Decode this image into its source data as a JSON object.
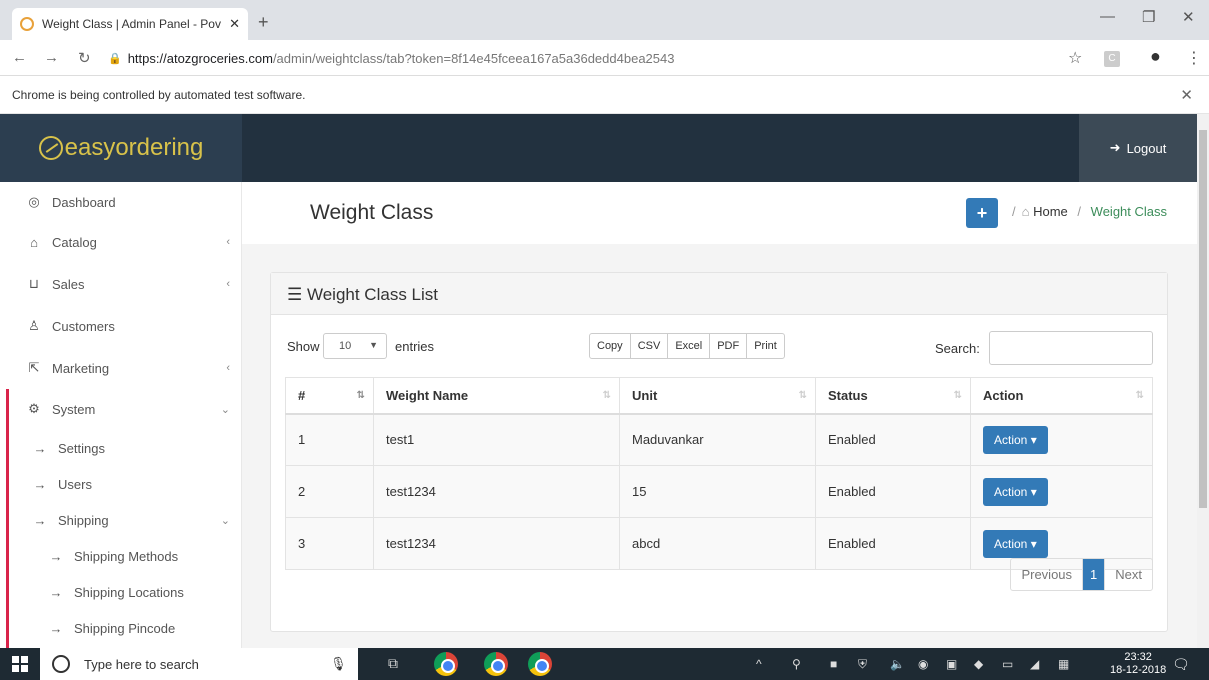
{
  "browser": {
    "tab_title": "Weight Class | Admin Panel - Pov",
    "url_host": "https://atozgroceries.com",
    "url_path": "/admin/weightclass/tab?token=8f14e45fceea167a5a36dedd4bea2543",
    "automation_notice": "Chrome is being controlled by automated test software."
  },
  "header": {
    "logo_text": "easyordering",
    "logout_label": "Logout"
  },
  "sidebar": {
    "items": [
      {
        "label": "Dashboard",
        "icon": "dashboard-icon"
      },
      {
        "label": "Catalog",
        "icon": "tag-icon"
      },
      {
        "label": "Sales",
        "icon": "cart-icon"
      },
      {
        "label": "Customers",
        "icon": "user-icon"
      },
      {
        "label": "Marketing",
        "icon": "share-icon"
      },
      {
        "label": "System",
        "icon": "gear-icon"
      },
      {
        "label": "Settings",
        "icon": "arrow-right-icon"
      },
      {
        "label": "Users",
        "icon": "arrow-right-icon"
      },
      {
        "label": "Shipping",
        "icon": "arrow-right-icon"
      },
      {
        "label": "Shipping Methods",
        "icon": "arrow-right-icon"
      },
      {
        "label": "Shipping Locations",
        "icon": "arrow-right-icon"
      },
      {
        "label": "Shipping Pincode",
        "icon": "arrow-right-icon"
      }
    ]
  },
  "page": {
    "title": "Weight Class",
    "breadcrumb_home": "Home",
    "breadcrumb_current": "Weight Class"
  },
  "panel": {
    "heading": "Weight Class List",
    "show_label": "Show",
    "entries_value": "10",
    "entries_label": "entries",
    "export_buttons": [
      "Copy",
      "CSV",
      "Excel",
      "PDF",
      "Print"
    ],
    "search_label": "Search:"
  },
  "table": {
    "headers": [
      "#",
      "Weight Name",
      "Unit",
      "Status",
      "Action"
    ],
    "rows": [
      {
        "num": "1",
        "name": "test1",
        "unit": "Maduvankar",
        "status": "Enabled",
        "action": "Action"
      },
      {
        "num": "2",
        "name": "test1234",
        "unit": "15",
        "status": "Enabled",
        "action": "Action"
      },
      {
        "num": "3",
        "name": "test1234",
        "unit": "abcd",
        "status": "Enabled",
        "action": "Action"
      }
    ]
  },
  "pagination": {
    "previous": "Previous",
    "current": "1",
    "next": "Next"
  },
  "taskbar": {
    "search_placeholder": "Type here to search",
    "time": "23:32",
    "date": "18-12-2018"
  }
}
